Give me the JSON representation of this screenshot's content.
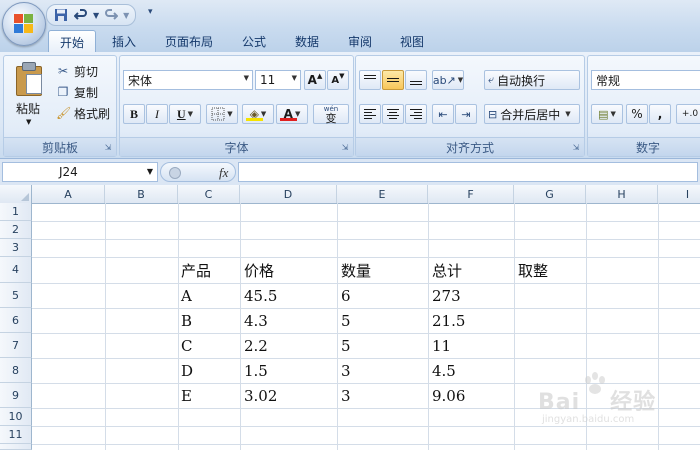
{
  "quick_access": {
    "save_icon": "save-icon",
    "undo_icon": "undo-icon",
    "redo_icon": "redo-icon"
  },
  "tabs": [
    {
      "label": "开始",
      "active": true
    },
    {
      "label": "插入",
      "active": false
    },
    {
      "label": "页面布局",
      "active": false
    },
    {
      "label": "公式",
      "active": false
    },
    {
      "label": "数据",
      "active": false
    },
    {
      "label": "审阅",
      "active": false
    },
    {
      "label": "视图",
      "active": false
    }
  ],
  "ribbon": {
    "clipboard": {
      "paste_label": "粘贴",
      "cut_label": "剪切",
      "copy_label": "复制",
      "format_painter_label": "格式刷",
      "group_label": "剪贴板"
    },
    "font": {
      "font_name": "宋体",
      "font_size": "11",
      "grow_label": "A",
      "shrink_label": "A",
      "bold_label": "B",
      "italic_label": "I",
      "underline_label": "U",
      "font_color_label": "A",
      "phonetic_label": "wén",
      "phonetic_char": "变",
      "group_label": "字体",
      "fill_color": "#f5e300",
      "font_color": "#e02020"
    },
    "alignment": {
      "wrap_text_label": "自动换行",
      "merge_center_label": "合并后居中",
      "group_label": "对齐方式"
    },
    "number": {
      "format_value": "常规",
      "percent_label": "%",
      "comma_label": ",",
      "decimal_label": "+.0",
      "group_label": "数字"
    }
  },
  "formula_bar": {
    "name_box": "J24",
    "fx_label": "fx",
    "formula": ""
  },
  "sheet": {
    "columns": [
      "A",
      "B",
      "C",
      "D",
      "E",
      "F",
      "G",
      "H",
      "I"
    ],
    "rows": [
      "1",
      "2",
      "3",
      "4",
      "5",
      "6",
      "7",
      "8",
      "9",
      "10",
      "11"
    ],
    "headers": [
      "产品",
      "价格",
      "数量",
      "总计",
      "取整"
    ],
    "data": [
      [
        "A",
        "45.5",
        "6",
        "273"
      ],
      [
        "B",
        "4.3",
        "5",
        "21.5"
      ],
      [
        "C",
        "2.2",
        "5",
        "11"
      ],
      [
        "D",
        "1.5",
        "3",
        "4.5"
      ],
      [
        "E",
        "3.02",
        "3",
        "9.06"
      ]
    ]
  },
  "watermark": {
    "text": "Bai",
    "text2": "经验",
    "sub": "jingyan.baidu.com"
  }
}
